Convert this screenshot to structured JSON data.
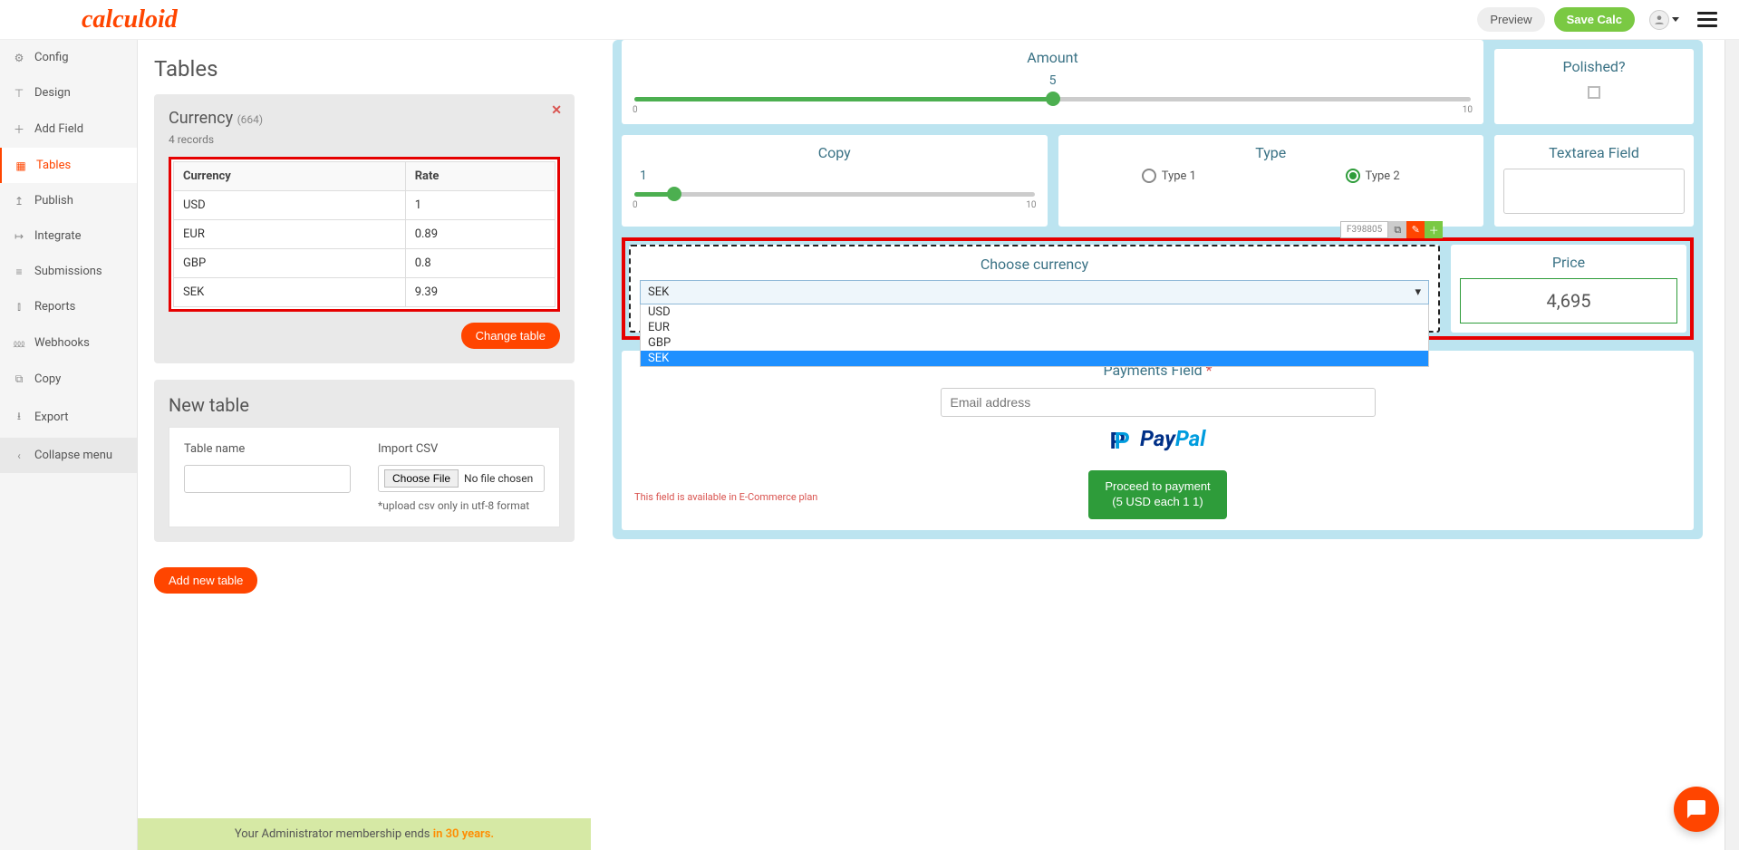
{
  "header": {
    "logo": "calculoid",
    "preview": "Preview",
    "save": "Save Calc"
  },
  "sidebar": {
    "items": [
      {
        "icon": "⚙",
        "label": "Config"
      },
      {
        "icon": "⊤",
        "label": "Design"
      },
      {
        "icon": "＋",
        "label": "Add Field"
      },
      {
        "icon": "▦",
        "label": "Tables"
      },
      {
        "icon": "↥",
        "label": "Publish"
      },
      {
        "icon": "↦",
        "label": "Integrate"
      },
      {
        "icon": "≡",
        "label": "Submissions"
      },
      {
        "icon": "⫾",
        "label": "Reports"
      },
      {
        "icon": "⅏",
        "label": "Webhooks"
      },
      {
        "icon": "⧉",
        "label": "Copy"
      },
      {
        "icon": "⭳",
        "label": "Export"
      },
      {
        "icon": "‹",
        "label": "Collapse menu"
      }
    ]
  },
  "tables_panel": {
    "heading": "Tables",
    "currency_title": "Currency",
    "currency_count": "(664)",
    "records": "4 records",
    "columns": [
      "Currency",
      "Rate"
    ],
    "rows": [
      {
        "c": "USD",
        "r": "1"
      },
      {
        "c": "EUR",
        "r": "0.89"
      },
      {
        "c": "GBP",
        "r": "0.8"
      },
      {
        "c": "SEK",
        "r": "9.39"
      }
    ],
    "change_table": "Change table",
    "new_table_heading": "New table",
    "table_name_label": "Table name",
    "import_csv_label": "Import CSV",
    "choose_file": "Choose File",
    "no_file": "No file chosen",
    "upload_hint": "*upload csv only in utf-8 format",
    "add_new": "Add new table"
  },
  "admin_banner": {
    "prefix": "Your Administrator membership ends ",
    "highlight": "in 30 years."
  },
  "preview_area": {
    "amount": {
      "title": "Amount",
      "value": "5",
      "min": "0",
      "max": "10"
    },
    "polished": {
      "title": "Polished?"
    },
    "copy": {
      "title": "Copy",
      "value": "1",
      "min": "0",
      "max": "10"
    },
    "type": {
      "title": "Type",
      "opt1": "Type 1",
      "opt2": "Type 2"
    },
    "textarea": {
      "title": "Textarea Field"
    },
    "field_id": "F398805",
    "choose_currency": {
      "title": "Choose currency",
      "selected": "SEK",
      "options": [
        "USD",
        "EUR",
        "GBP",
        "SEK"
      ]
    },
    "price": {
      "title": "Price",
      "value": "4,695"
    },
    "payments": {
      "title": "Payments Field",
      "email_ph": "Email address",
      "paypal": "PayPal",
      "proceed_line1": "Proceed to payment",
      "proceed_line2": "(5 USD each 1 1)",
      "ecomm": "This field is available in E-Commerce plan"
    }
  }
}
